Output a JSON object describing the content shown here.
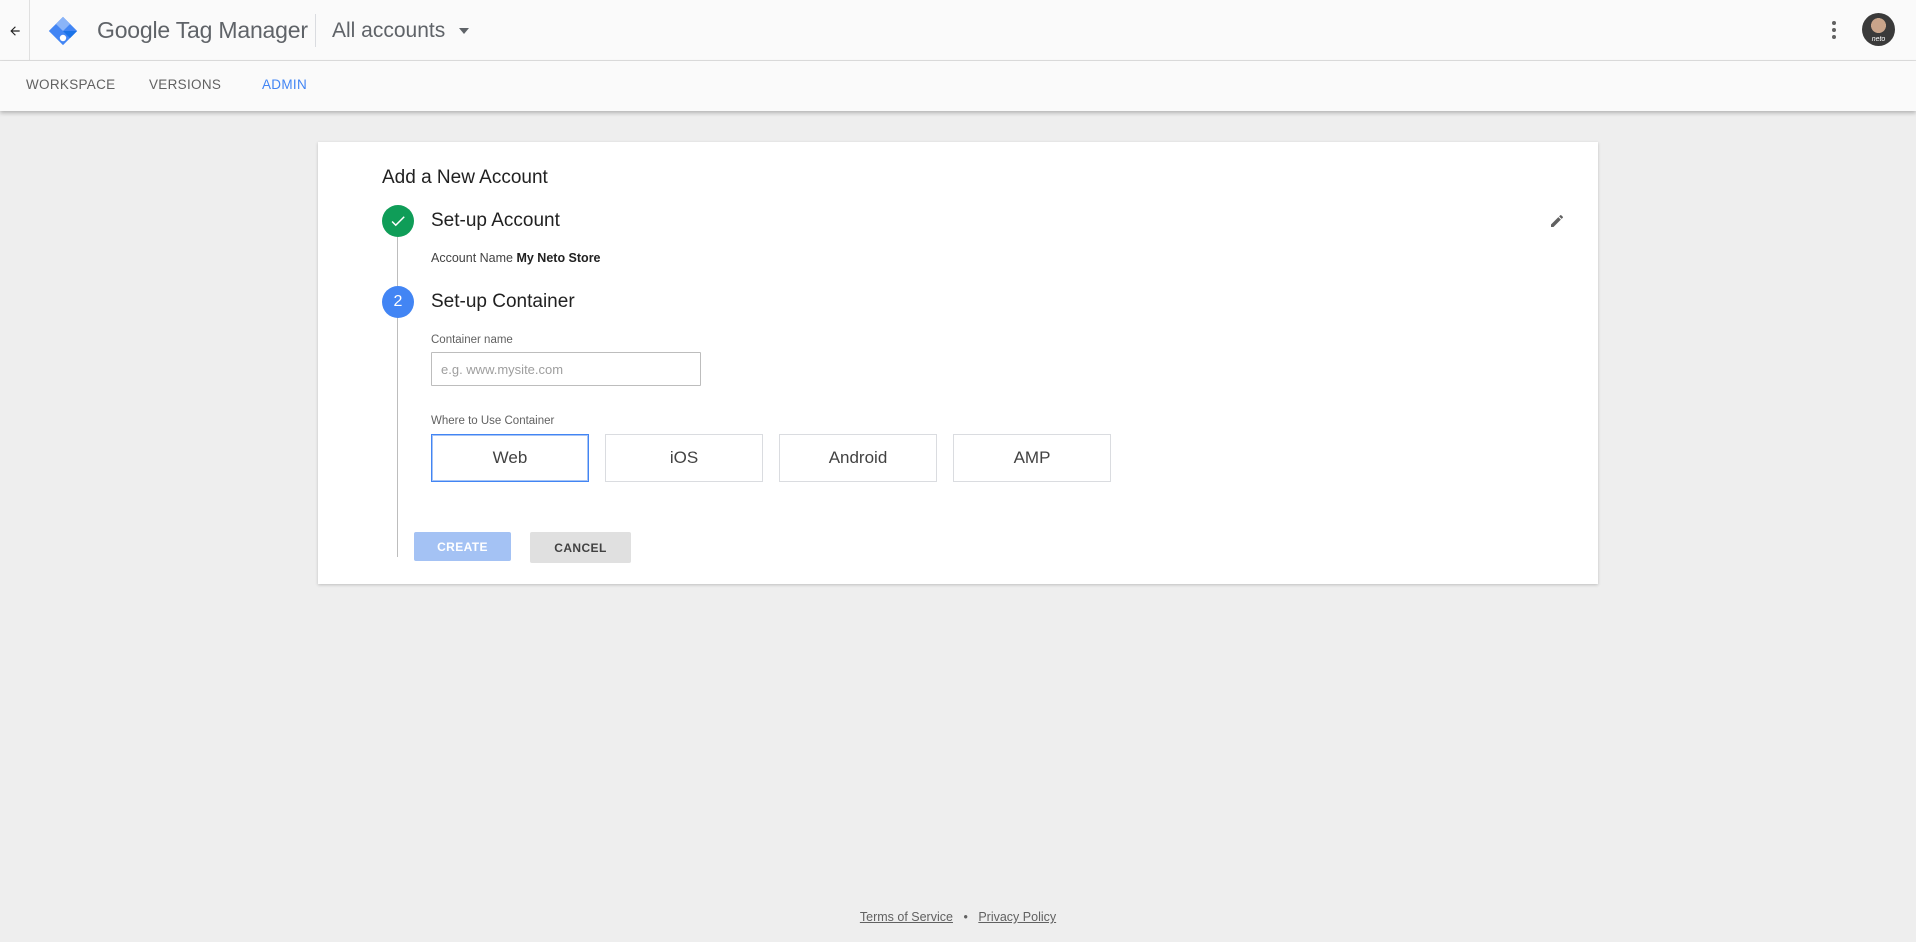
{
  "header": {
    "back_icon": "arrow-left-icon",
    "logo_icon": "tag-manager-diamond-icon",
    "product_google": "Google",
    "product_rest": " Tag Manager",
    "account_switcher": "All accounts",
    "menu_icon": "more-vert-icon",
    "avatar_label": "neto"
  },
  "nav": {
    "tabs": [
      {
        "label": "WORKSPACE",
        "active": false
      },
      {
        "label": "VERSIONS",
        "active": false
      },
      {
        "label": "ADMIN",
        "active": true
      }
    ]
  },
  "card": {
    "title": "Add a New Account",
    "step1": {
      "title": "Set-up Account",
      "status": "complete",
      "account_name_label": "Account Name",
      "account_name_value": "My Neto Store"
    },
    "step2": {
      "number": "2",
      "title": "Set-up Container",
      "container_name_label": "Container name",
      "container_name_value": "",
      "container_name_placeholder": "e.g. www.mysite.com",
      "where_label": "Where to Use Container",
      "options": [
        {
          "label": "Web",
          "selected": true
        },
        {
          "label": "iOS",
          "selected": false
        },
        {
          "label": "Android",
          "selected": false
        },
        {
          "label": "AMP",
          "selected": false
        }
      ]
    },
    "create_label": "CREATE",
    "cancel_label": "CANCEL"
  },
  "footer": {
    "terms": "Terms of Service",
    "separator": "•",
    "privacy": "Privacy Policy"
  },
  "colors": {
    "accent": "#4285f4",
    "success": "#0f9d58",
    "create_disabled": "#a4c2f4",
    "background": "#eeeeee"
  }
}
